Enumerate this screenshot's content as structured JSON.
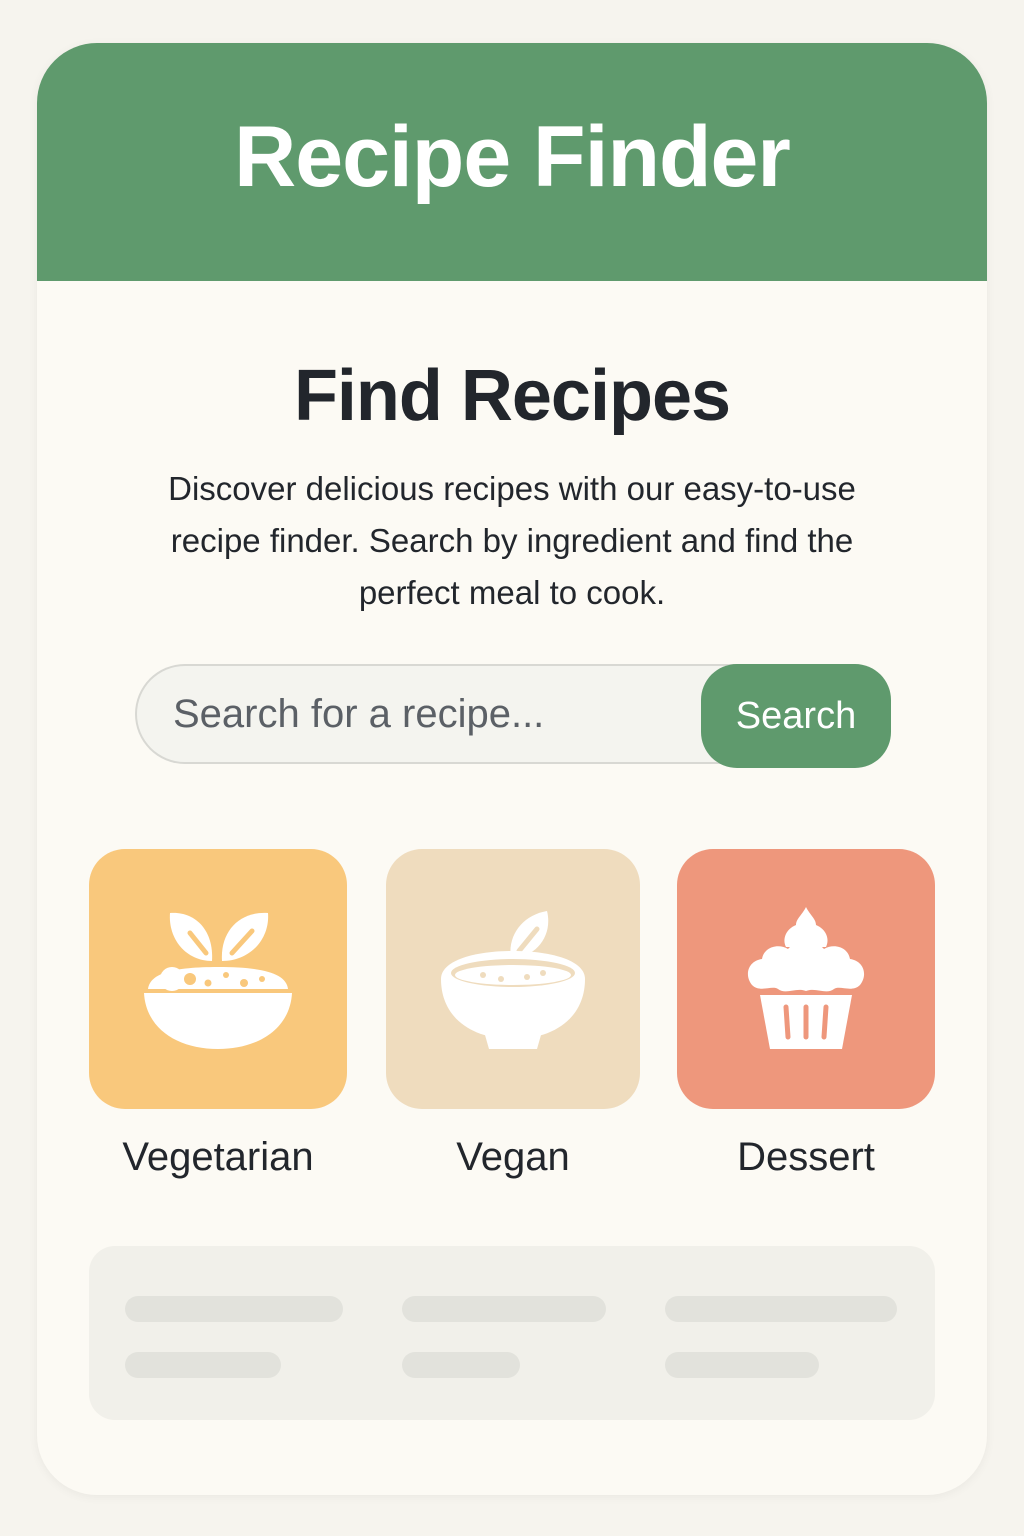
{
  "header": {
    "title": "Recipe Finder"
  },
  "main": {
    "title": "Find Recipes",
    "description": "Discover delicious recipes with our easy-to-use recipe finder. Search by ingredient and find the perfect meal to cook."
  },
  "search": {
    "placeholder": "Search for a recipe...",
    "value": "",
    "button_label": "Search"
  },
  "categories": [
    {
      "label": "Vegetarian",
      "icon": "salad-bowl-icon",
      "color": "#f9c87c"
    },
    {
      "label": "Vegan",
      "icon": "bowl-leaf-icon",
      "color": "#efdcbe"
    },
    {
      "label": "Dessert",
      "icon": "cupcake-icon",
      "color": "#ee977c"
    }
  ],
  "colors": {
    "accent": "#5f9a6d",
    "background": "#fcfaf4",
    "text": "#22262c"
  }
}
